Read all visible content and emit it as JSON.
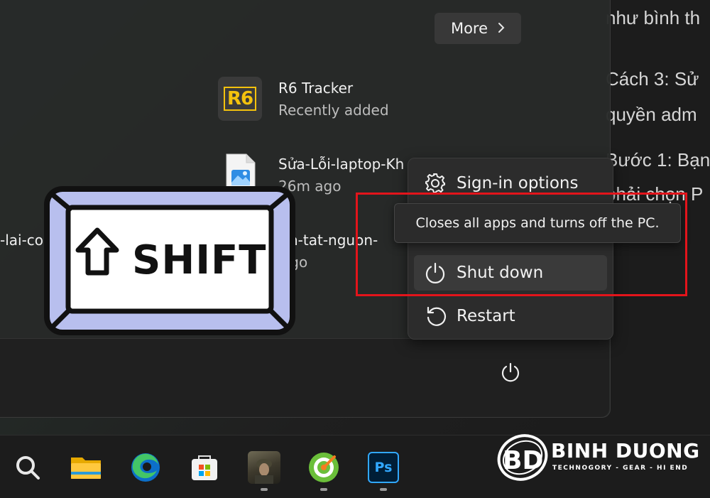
{
  "article": {
    "lines": [
      "như bình th",
      "Cách 3: Sử",
      "quyền adm",
      "Bước 1: Bạn",
      "phải chọn P"
    ]
  },
  "start_menu": {
    "more_label": "More",
    "recommended": [
      {
        "title": "R6 Tracker",
        "subtitle": "Recently added",
        "icon": "r6-tracker-icon",
        "icon_text": "R6"
      },
      {
        "title": "Sửa-Lỗi-laptop-Kh",
        "subtitle": "26m ago",
        "icon": "image-file-icon"
      },
      {
        "title": "ch-tat-nguon-",
        "subtitle": "ago",
        "icon": "image-file-icon"
      }
    ],
    "left_partial": "-lai-co"
  },
  "power_menu": {
    "items": [
      {
        "label": "Sign-in options",
        "icon": "gear-icon"
      },
      {
        "label": "Shut down",
        "icon": "power-icon"
      },
      {
        "label": "Restart",
        "icon": "restart-icon"
      }
    ],
    "tooltip": "Closes all apps and turns off the PC.",
    "highlight_color": "#e3141b"
  },
  "shift_key": {
    "label": "SHIFT",
    "fill": "#b8bfee"
  },
  "taskbar": {
    "icons": [
      "search-icon",
      "file-explorer-icon",
      "edge-icon",
      "microsoft-store-icon",
      "game-icon",
      "coc-coc-icon",
      "photoshop-icon"
    ],
    "photoshop_label": "Ps"
  },
  "watermark": {
    "monogram": "BD",
    "name": "BINH DUONG",
    "tagline": "TECHNOGORY - GEAR - HI END"
  }
}
